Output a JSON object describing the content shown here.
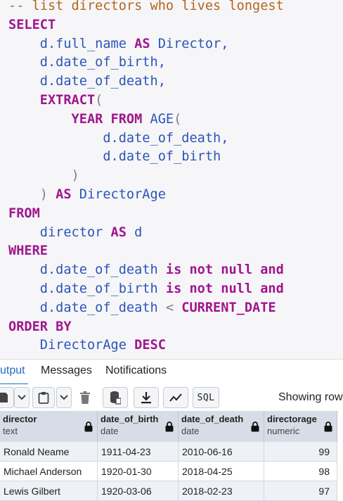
{
  "editor": {
    "lines": [
      [
        {
          "t": "-- list directors who lives longest",
          "c": "comment"
        }
      ],
      [
        {
          "t": "SELECT",
          "c": "keyword"
        }
      ],
      [
        {
          "t": "    d.full_name ",
          "c": "blue"
        },
        {
          "t": "AS",
          "c": "keyword"
        },
        {
          "t": " Director,",
          "c": "blue"
        }
      ],
      [
        {
          "t": "    d.date_of_birth,",
          "c": "blue"
        }
      ],
      [
        {
          "t": "    d.date_of_death,",
          "c": "blue"
        }
      ],
      [
        {
          "t": "    EXTRACT",
          "c": "keyword"
        },
        {
          "t": "(",
          "c": "paren"
        }
      ],
      [
        {
          "t": "        YEAR FROM",
          "c": "keyword"
        },
        {
          "t": " AGE",
          "c": "blue"
        },
        {
          "t": "(",
          "c": "paren"
        }
      ],
      [
        {
          "t": "            d.date_of_death,",
          "c": "blue"
        }
      ],
      [
        {
          "t": "            d.date_of_birth",
          "c": "blue"
        }
      ],
      [
        {
          "t": "        )",
          "c": "paren"
        }
      ],
      [
        {
          "t": "    ) ",
          "c": "paren"
        },
        {
          "t": "AS",
          "c": "keyword"
        },
        {
          "t": " DirectorAge",
          "c": "blue"
        }
      ],
      [
        {
          "t": "FROM",
          "c": "keyword"
        }
      ],
      [
        {
          "t": "    director ",
          "c": "blue"
        },
        {
          "t": "AS",
          "c": "keyword"
        },
        {
          "t": " d",
          "c": "blue"
        }
      ],
      [
        {
          "t": "WHERE",
          "c": "keyword"
        }
      ],
      [
        {
          "t": "    d.date_of_death ",
          "c": "blue"
        },
        {
          "t": "is not null and",
          "c": "keyword"
        }
      ],
      [
        {
          "t": "    d.date_of_birth ",
          "c": "blue"
        },
        {
          "t": "is not null and",
          "c": "keyword"
        }
      ],
      [
        {
          "t": "    d.date_of_death ",
          "c": "blue"
        },
        {
          "t": "< ",
          "c": "paren"
        },
        {
          "t": "CURRENT_DATE",
          "c": "keyword"
        }
      ],
      [
        {
          "t": "ORDER BY",
          "c": "keyword"
        }
      ],
      [
        {
          "t": "    DirectorAge ",
          "c": "blue"
        },
        {
          "t": "DESC",
          "c": "keyword"
        }
      ]
    ]
  },
  "tabs": {
    "output": "utput",
    "messages": "Messages",
    "notifications": "Notifications"
  },
  "toolbar": {
    "icons": [
      "add-row-icon",
      "chevron-down-icon",
      "paste-icon",
      "chevron-down-icon",
      "delete-icon",
      "save-data-icon",
      "download-icon",
      "graph-icon"
    ],
    "sql_label": "SQL",
    "showing_text": "Showing row"
  },
  "grid": {
    "columns": [
      {
        "name": "director",
        "type": "text"
      },
      {
        "name": "date_of_birth",
        "type": "date"
      },
      {
        "name": "date_of_death",
        "type": "date"
      },
      {
        "name": "directorage",
        "type": "numeric"
      }
    ],
    "rows": [
      [
        "Ronald Neame",
        "1911-04-23",
        "2010-06-16",
        "99"
      ],
      [
        "Michael Anderson",
        "1920-01-30",
        "2018-04-25",
        "98"
      ],
      [
        "Lewis Gilbert",
        "1920-03-06",
        "2018-02-23",
        "97"
      ]
    ],
    "colors": {
      "header_bg": "#d7dde6",
      "row_odd": "#eef1f5",
      "row_even": "#ffffff"
    }
  }
}
